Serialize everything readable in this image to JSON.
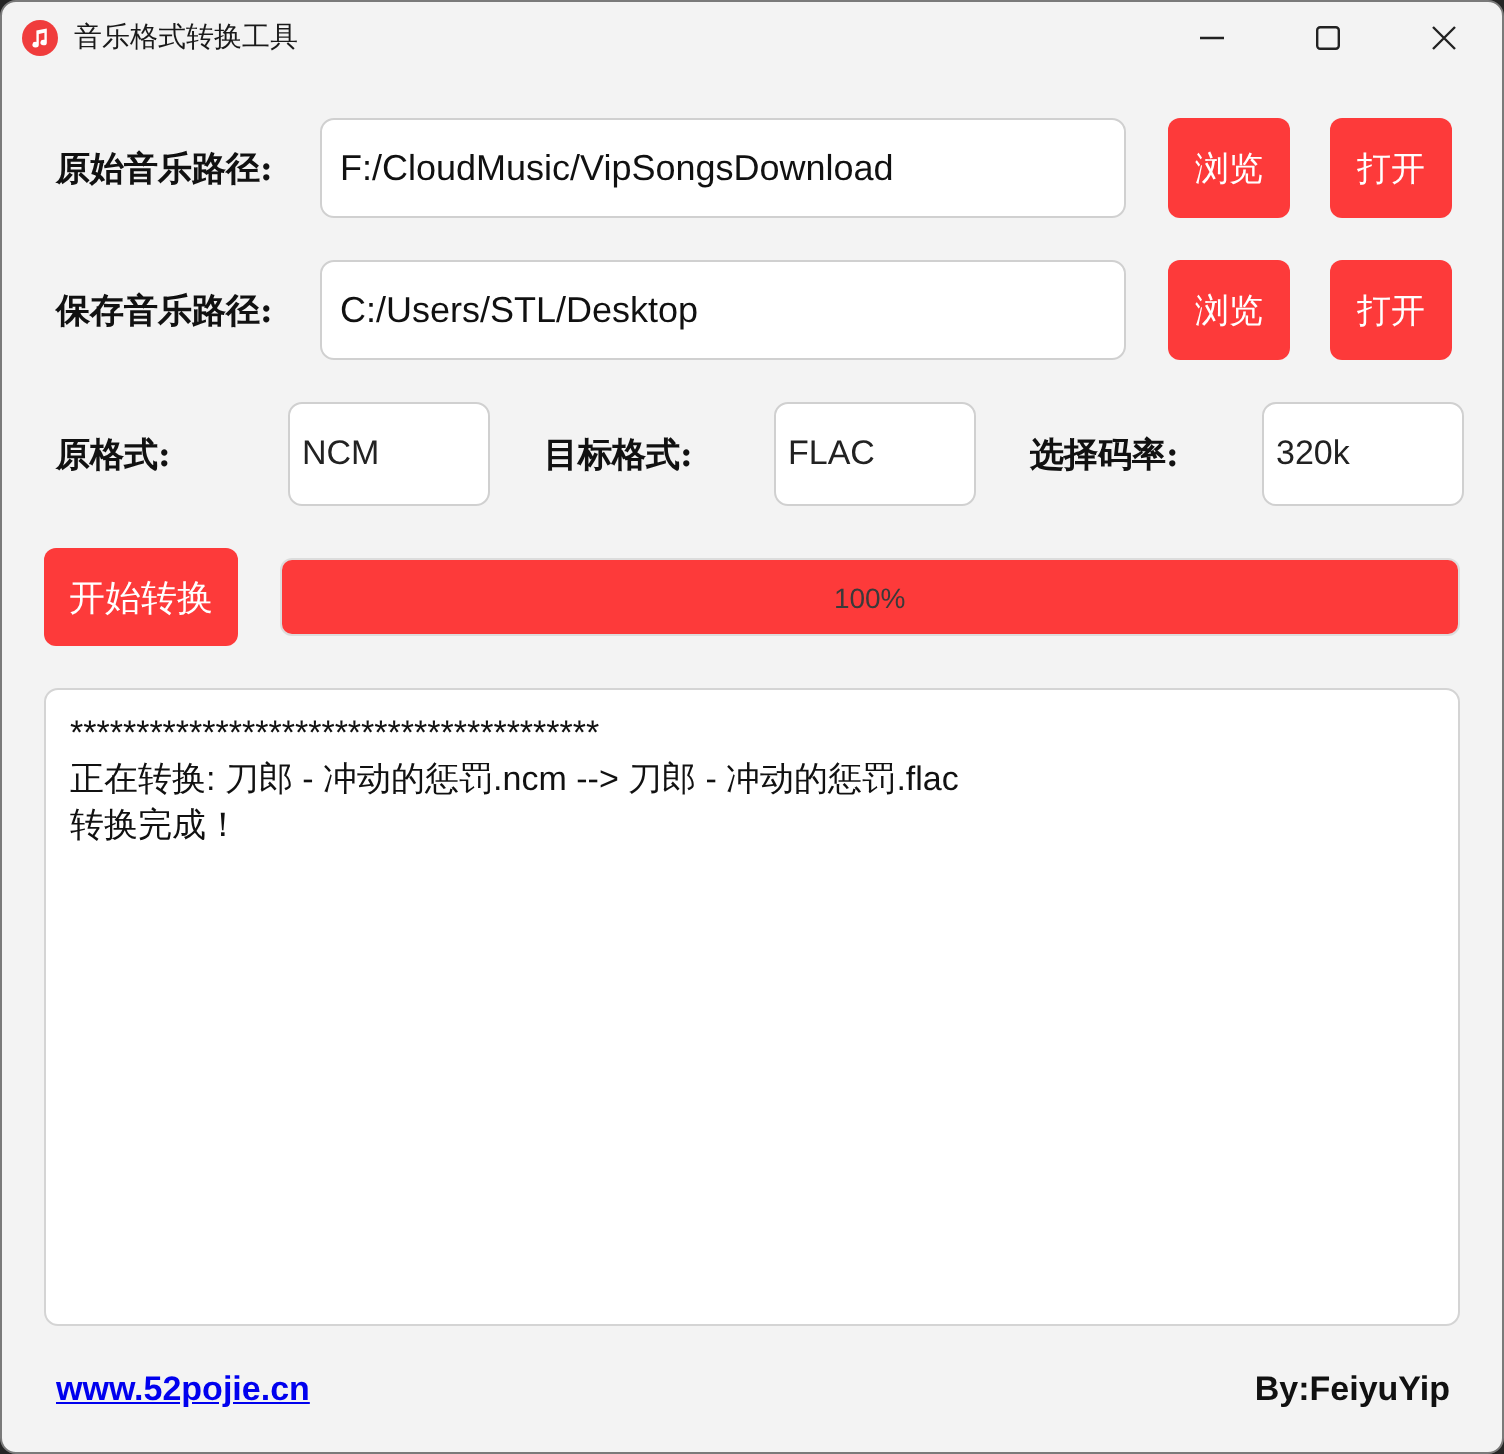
{
  "window": {
    "title": "音乐格式转换工具"
  },
  "paths": [
    {
      "label": "原始音乐路径:",
      "value": "F:/CloudMusic/VipSongsDownload",
      "buttons": [
        "浏览",
        "打开"
      ]
    },
    {
      "label": "保存音乐路径:",
      "value": "C:/Users/STL/Desktop",
      "buttons": [
        "浏览",
        "打开"
      ]
    }
  ],
  "formats": [
    {
      "label": "原格式:",
      "value": "NCM"
    },
    {
      "label": "目标格式:",
      "value": "FLAC"
    },
    {
      "label": "选择码率:",
      "value": "320k"
    }
  ],
  "convert": {
    "button": "开始转换",
    "progress": {
      "level": 1,
      "text": "100%"
    }
  },
  "log": {
    "lines": [
      "****************************************",
      "正在转换: 刀郎 - 冲动的惩罚.ncm --> 刀郎 - 冲动的惩罚.flac",
      "转换完成！"
    ]
  },
  "footer": {
    "link": "www.52pojie.cn",
    "credit": "By:FeiyuYip"
  }
}
